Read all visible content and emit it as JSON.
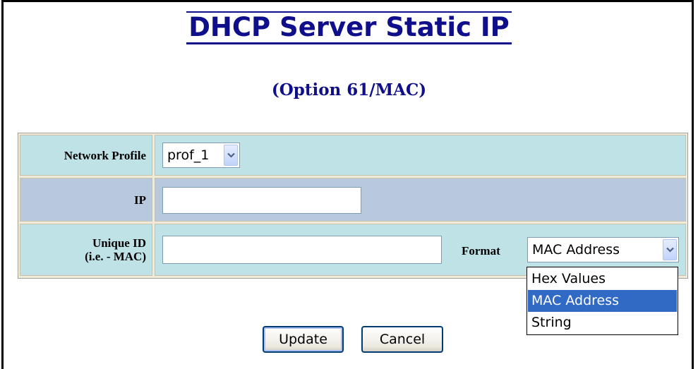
{
  "page": {
    "title": "DHCP Server Static IP",
    "subtitle": "(Option 61/MAC)"
  },
  "form": {
    "network_profile": {
      "label": "Network Profile",
      "value": "prof_1"
    },
    "ip": {
      "label": "IP",
      "value": ""
    },
    "unique_id": {
      "label_line1": "Unique ID",
      "label_line2": "(i.e. - MAC)",
      "value": ""
    },
    "format": {
      "label": "Format",
      "value": "MAC Address",
      "options": [
        "Hex Values",
        "MAC Address",
        "String"
      ],
      "selected_option": "MAC Address"
    }
  },
  "buttons": {
    "update": "Update",
    "cancel": "Cancel"
  },
  "colors": {
    "title": "#0f0f8c",
    "row_teal": "#bfe2e6",
    "row_steel": "#b8c8dd",
    "dropdown_highlight": "#316ac5"
  },
  "icons": {
    "select_arrow": "chevron-down-icon"
  }
}
